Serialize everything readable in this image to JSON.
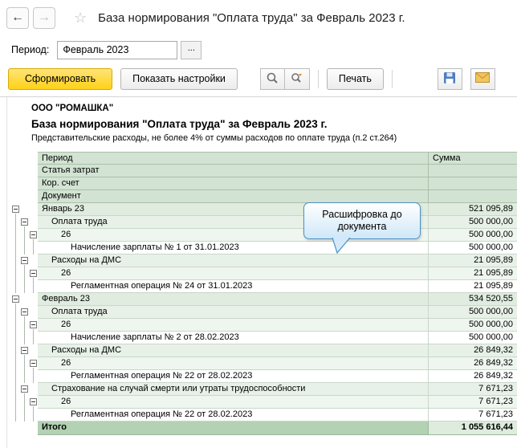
{
  "nav": {
    "back": "←",
    "forward": "→",
    "star": "☆",
    "title": "База нормирования \"Оплата труда\" за Февраль 2023 г."
  },
  "period": {
    "label": "Период:",
    "value": "Февраль 2023",
    "picker": "..."
  },
  "toolbar": {
    "generate": "Сформировать",
    "settings": "Показать настройки",
    "print": "Печать"
  },
  "tooltip": {
    "text": "Расшифровка до документа"
  },
  "colors": {
    "accent_yellow": "#ffd117",
    "header_green": "#d3e3d3",
    "total_green": "#b3d1b3",
    "tooltip_blue": "#4a90c2"
  },
  "report": {
    "company": "ООО \"РОМАШКА\"",
    "title": "База нормирования \"Оплата труда\" за Февраль 2023 г.",
    "note": "Представительские расходы, не более 4% от суммы расходов по оплате труда (п.2 ст.264)",
    "header_rows": [
      "Период",
      "Статья затрат",
      "Кор. счет",
      "Документ"
    ],
    "sum_header": "Сумма",
    "rows": [
      {
        "label": "Январь 23",
        "sum": "521 095,89",
        "level": 0,
        "box": true,
        "lines": []
      },
      {
        "label": "Оплата труда",
        "sum": "500 000,00",
        "level": 1,
        "box": true,
        "lines": [
          0
        ]
      },
      {
        "label": "26",
        "sum": "500 000,00",
        "level": 2,
        "box": true,
        "lines": [
          0,
          1
        ]
      },
      {
        "label": "Начисление зарплаты № 1 от 31.01.2023",
        "sum": "500 000,00",
        "level": 3,
        "box": false,
        "lines": [
          0,
          1,
          2
        ]
      },
      {
        "label": "Расходы на ДМС",
        "sum": "21 095,89",
        "level": 1,
        "box": true,
        "lines": [
          0
        ]
      },
      {
        "label": "26",
        "sum": "21 095,89",
        "level": 2,
        "box": true,
        "lines": [
          0,
          1
        ]
      },
      {
        "label": "Регламентная операция № 24 от 31.01.2023",
        "sum": "21 095,89",
        "level": 3,
        "box": false,
        "lines": [
          0,
          1,
          2
        ]
      },
      {
        "label": "Февраль 23",
        "sum": "534 520,55",
        "level": 0,
        "box": true,
        "lines": []
      },
      {
        "label": "Оплата труда",
        "sum": "500 000,00",
        "level": 1,
        "box": true,
        "lines": [
          0
        ]
      },
      {
        "label": "26",
        "sum": "500 000,00",
        "level": 2,
        "box": true,
        "lines": [
          0,
          1
        ]
      },
      {
        "label": "Начисление зарплаты № 2 от 28.02.2023",
        "sum": "500 000,00",
        "level": 3,
        "box": false,
        "lines": [
          0,
          1,
          2
        ]
      },
      {
        "label": "Расходы на ДМС",
        "sum": "26 849,32",
        "level": 1,
        "box": true,
        "lines": [
          0
        ]
      },
      {
        "label": "26",
        "sum": "26 849,32",
        "level": 2,
        "box": true,
        "lines": [
          0,
          1
        ]
      },
      {
        "label": "Регламентная операция № 22 от 28.02.2023",
        "sum": "26 849,32",
        "level": 3,
        "box": false,
        "lines": [
          0,
          1,
          2
        ]
      },
      {
        "label": "Страхование на случай смерти или утраты трудоспособности",
        "sum": "7 671,23",
        "level": 1,
        "box": true,
        "lines": [
          0
        ]
      },
      {
        "label": "26",
        "sum": "7 671,23",
        "level": 2,
        "box": true,
        "lines": [
          0,
          1
        ]
      },
      {
        "label": "Регламентная операция № 22 от 28.02.2023",
        "sum": "7 671,23",
        "level": 3,
        "box": false,
        "lines": [
          0,
          1,
          2
        ]
      }
    ],
    "total": {
      "label": "Итого",
      "sum": "1 055 616,44"
    }
  }
}
